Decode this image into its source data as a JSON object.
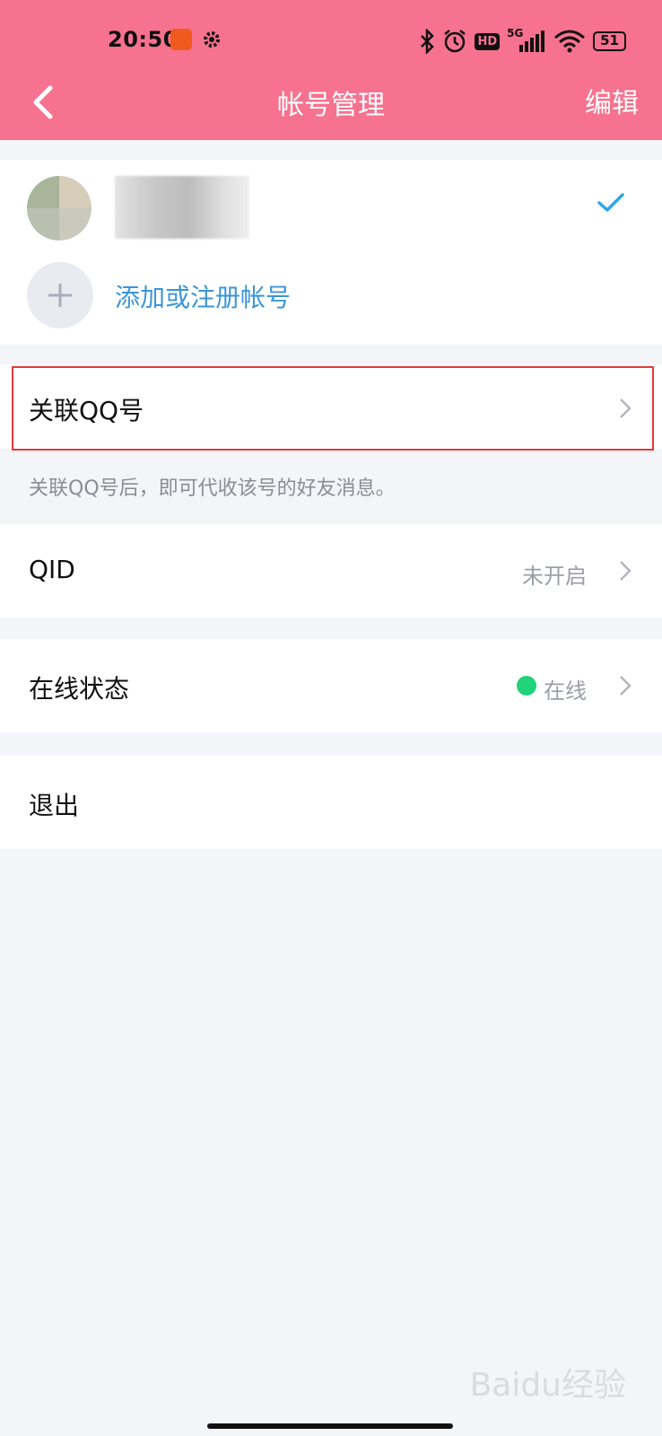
{
  "status_bar": {
    "time": "20:50",
    "network": "5G",
    "hd": "HD",
    "battery": "51"
  },
  "nav": {
    "title": "帐号管理",
    "edit": "编辑"
  },
  "accounts": {
    "add_label": "添加或注册帐号"
  },
  "link_qq": {
    "label": "关联QQ号",
    "hint": "关联QQ号后，即可代收该号的好友消息。"
  },
  "qid": {
    "label": "QID",
    "value": "未开启"
  },
  "online_status": {
    "label": "在线状态",
    "value": "在线",
    "dot_color": "#20d27a"
  },
  "logout": {
    "label": "退出"
  },
  "colors": {
    "header": "#f6728f",
    "accent": "#3c95d9",
    "highlight": "#e33b3b"
  },
  "watermark": "Baidu经验"
}
